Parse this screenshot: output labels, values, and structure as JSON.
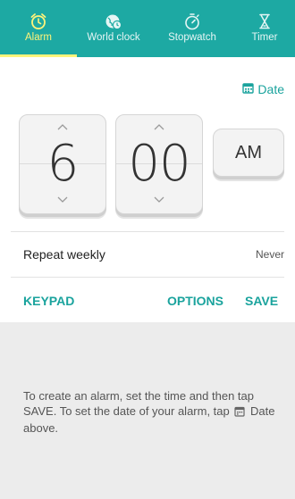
{
  "tabs": [
    {
      "label": "Alarm",
      "icon": "alarm-icon",
      "active": true
    },
    {
      "label": "World clock",
      "icon": "world-clock-icon",
      "active": false
    },
    {
      "label": "Stopwatch",
      "icon": "stopwatch-icon",
      "active": false
    },
    {
      "label": "Timer",
      "icon": "timer-icon",
      "active": false
    }
  ],
  "date_link": {
    "label": "Date",
    "icon": "calendar-icon"
  },
  "time": {
    "hour": "6",
    "minute": "00",
    "ampm": "AM"
  },
  "repeat": {
    "label": "Repeat weekly",
    "value": "Never"
  },
  "actions": {
    "keypad": "KEYPAD",
    "options": "OPTIONS",
    "save": "SAVE"
  },
  "help": {
    "part1": "To create an alarm, set the time and then tap SAVE. To set the date of your alarm, tap",
    "part2": "Date above."
  },
  "colors": {
    "accent": "#1da9a3",
    "active_tab": "#fff47a",
    "link": "#1aa39d"
  }
}
